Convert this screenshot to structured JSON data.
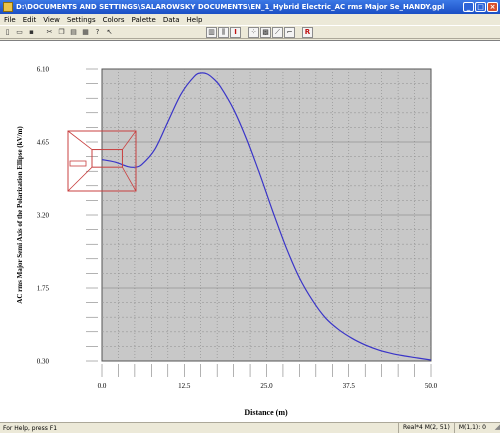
{
  "window": {
    "title": "D:\\DOCUMENTS AND SETTINGS\\SALAROWSKY DOCUMENTS\\EN_1_Hybrid Electric_AC rms Major Se_HANDY.gpl"
  },
  "menu": {
    "items": [
      "File",
      "Edit",
      "View",
      "Settings",
      "Colors",
      "Palette",
      "Data",
      "Help"
    ]
  },
  "statusbar": {
    "help": "For Help, press F1",
    "coords": "Real*4 M(2, 51)",
    "value": "M(1,1): 0"
  },
  "colors": {
    "plot_bg": "#c8c8c8",
    "curve": "#3a35c8",
    "zoom_box": "#c84040"
  },
  "chart_data": {
    "type": "line",
    "xlabel": "Distance (m)",
    "ylabel": "AC rms Major Semi Axis of the Polarization Ellipse (kV/m)",
    "xlim": [
      0,
      50
    ],
    "ylim": [
      0.3,
      6.1
    ],
    "x_ticks": [
      "0.0",
      "12.5",
      "25.0",
      "37.5",
      "50.0"
    ],
    "y_ticks": [
      "6.10",
      "4.65",
      "3.20",
      "1.75",
      "0.30"
    ],
    "grid": true,
    "series": [
      {
        "x": [
          0,
          2,
          4,
          5,
          6,
          8,
          10,
          12,
          14,
          15,
          16,
          17,
          18,
          20,
          22,
          24,
          26,
          28,
          30,
          32,
          34,
          36,
          38,
          40,
          42,
          44,
          46,
          48,
          50
        ],
        "y": [
          4.3,
          4.25,
          4.16,
          4.15,
          4.2,
          4.5,
          5.05,
          5.6,
          5.95,
          6.02,
          6.0,
          5.9,
          5.75,
          5.3,
          4.7,
          4.0,
          3.25,
          2.55,
          1.95,
          1.5,
          1.15,
          0.92,
          0.75,
          0.62,
          0.52,
          0.45,
          0.4,
          0.36,
          0.32
        ]
      }
    ],
    "zoom_inset": {
      "x": [
        0,
        2.5
      ],
      "y": [
        4.15,
        4.5
      ]
    }
  }
}
